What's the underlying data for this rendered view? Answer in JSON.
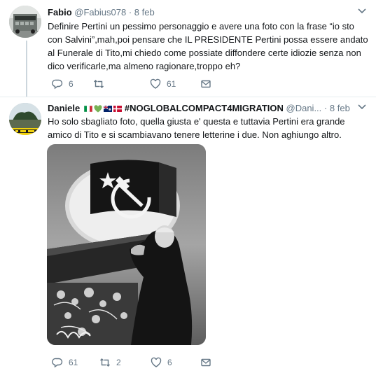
{
  "tweets": [
    {
      "display_name": "Fabio",
      "handle": "@Fabius078",
      "date": "8 feb",
      "text": "Definire Pertini un pessimo personaggio e avere una foto con la frase “io sto con Salvini”,mah,poi pensare che IL PRESIDENTE Pertini possa essere andato al Funerale di Tito,mi chiedo come possiate diffondere certe idiozie senza non dico verificarle,ma almeno ragionare,troppo eh?",
      "replies": "6",
      "retweets": "",
      "likes": "61"
    },
    {
      "display_name": "Daniele",
      "name_suffix": "#NOGLOBALCOMPACT4MIGRATION",
      "handle": "@Dani...",
      "date": "8 feb",
      "text": "Ho solo sbagliato foto, quella giusta e' questa e tuttavia Pertini era grande amico di Tito e si scambiavano tenere letterine i due.  Non aghiungo altro.",
      "replies": "61",
      "retweets": "2",
      "likes": "6"
    }
  ],
  "icons": {
    "reply": "reply-icon",
    "retweet": "retweet-icon",
    "like": "heart-icon",
    "dm": "envelope-icon",
    "caret": "chevron-down-icon"
  },
  "colors": {
    "meta": "#657786",
    "thread_line": "#ccd6dd",
    "flag_italy": [
      "#009246",
      "#ffffff",
      "#ce2b37"
    ],
    "heart_green": "#77b255",
    "flag_uk": "#012169",
    "flag_denmark": "#c60c30"
  }
}
